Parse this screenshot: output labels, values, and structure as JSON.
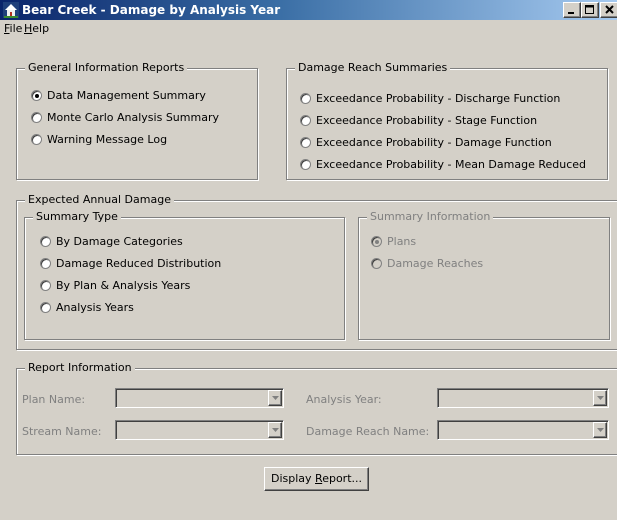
{
  "window": {
    "title": "Bear Creek - Damage by Analysis Year",
    "minimize_icon": "minimize-icon",
    "maximize_icon": "maximize-icon",
    "close_icon": "close-icon",
    "app_icon": "house-chart-icon"
  },
  "menu": {
    "file_key": "F",
    "file_rest": "ile",
    "help_key": "H",
    "help_rest": "elp"
  },
  "general_info": {
    "legend": "General Information Reports",
    "options": [
      {
        "label": "Data Management Summary",
        "checked": true
      },
      {
        "label": "Monte Carlo Analysis Summary",
        "checked": false
      },
      {
        "label": "Warning Message Log",
        "checked": false
      }
    ]
  },
  "damage_reach": {
    "legend": "Damage Reach Summaries",
    "options": [
      {
        "label": "Exceedance Probability - Discharge Function",
        "checked": false
      },
      {
        "label": "Exceedance Probability - Stage Function",
        "checked": false
      },
      {
        "label": "Exceedance Probability - Damage Function",
        "checked": false
      },
      {
        "label": "Exceedance Probability - Mean Damage Reduced",
        "checked": false
      }
    ]
  },
  "expected_annual": {
    "legend": "Expected Annual Damage",
    "summary_type": {
      "legend": "Summary Type",
      "options": [
        {
          "label": "By Damage Categories",
          "checked": false
        },
        {
          "label": "Damage Reduced Distribution",
          "checked": false
        },
        {
          "label": "By Plan & Analysis Years",
          "checked": false
        },
        {
          "label": "Analysis Years",
          "checked": false
        }
      ]
    },
    "summary_info": {
      "legend": "Summary Information",
      "options": [
        {
          "label": "Plans",
          "checked": true
        },
        {
          "label": "Damage Reaches",
          "checked": false
        }
      ]
    }
  },
  "report_info": {
    "legend": "Report Information",
    "plan_name_label": "Plan Name:",
    "plan_name_value": "",
    "stream_name_label": "Stream Name:",
    "stream_name_value": "",
    "analysis_year_label": "Analysis Year:",
    "analysis_year_value": "",
    "damage_reach_label": "Damage Reach Name:",
    "damage_reach_value": ""
  },
  "display_button": {
    "prefix": "Display ",
    "key": "R",
    "rest": "eport..."
  }
}
